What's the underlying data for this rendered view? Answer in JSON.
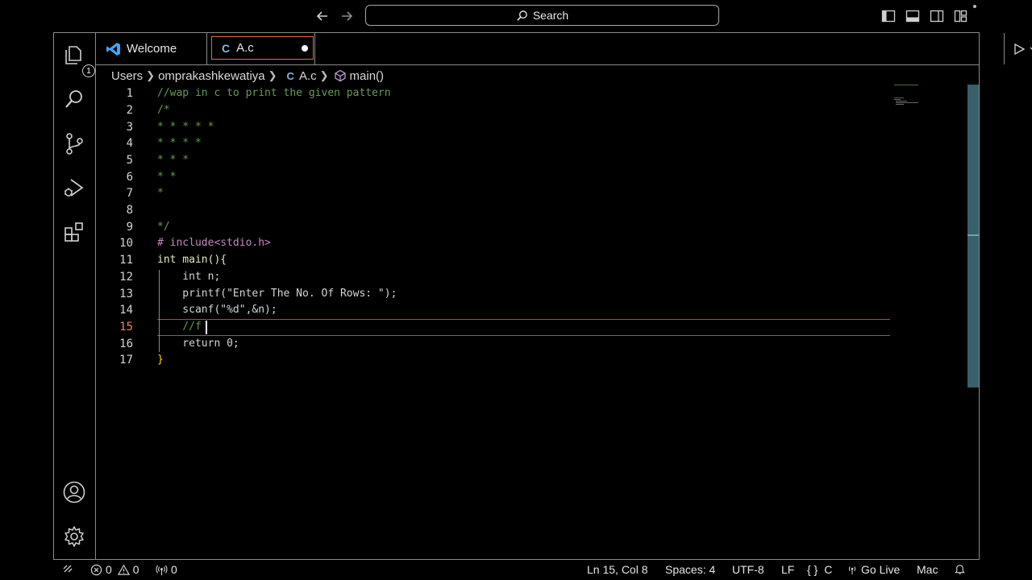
{
  "titlebar": {
    "search_label": "Search"
  },
  "activity": {
    "explorer_badge": "1"
  },
  "tabs": [
    {
      "label": "Welcome",
      "icon": "vscode-logo-icon"
    },
    {
      "label": "A.c",
      "icon": "c-file-icon",
      "modified": true
    }
  ],
  "breadcrumb": {
    "items": [
      "Users",
      "omprakashkewatiya",
      "A.c",
      "main()"
    ]
  },
  "editor": {
    "line_numbers": [
      "1",
      "2",
      "3",
      "4",
      "5",
      "6",
      "7",
      "8",
      "9",
      "10",
      "11",
      "12",
      "13",
      "14",
      "15",
      "16",
      "17"
    ],
    "active_line": "15",
    "lines": [
      "//wap in c to print the given pattern",
      "/*",
      "* * * * *",
      "* * * *",
      "* * *",
      "* *",
      "*",
      "",
      "*/",
      "# include<stdio.h>",
      "int main(){",
      "    int n;",
      "    printf(\"Enter The No. Of Rows: \");",
      "    scanf(\"%d\",&n);",
      "    //f",
      "    return 0;",
      "}"
    ]
  },
  "statusbar": {
    "errors": "0",
    "warnings": "0",
    "ports": "0",
    "position": "Ln 15, Col 8",
    "spaces": "Spaces: 4",
    "encoding": "UTF-8",
    "eol": "LF",
    "language": "C",
    "go_live": "Go Live",
    "platform": "Mac"
  },
  "colors": {
    "accent": "#e06c4a",
    "comment": "#6a9955",
    "keyword": "#569cd6",
    "string": "#ce9178",
    "preprocessor": "#c586c0",
    "scrollbar": "#37606b"
  }
}
